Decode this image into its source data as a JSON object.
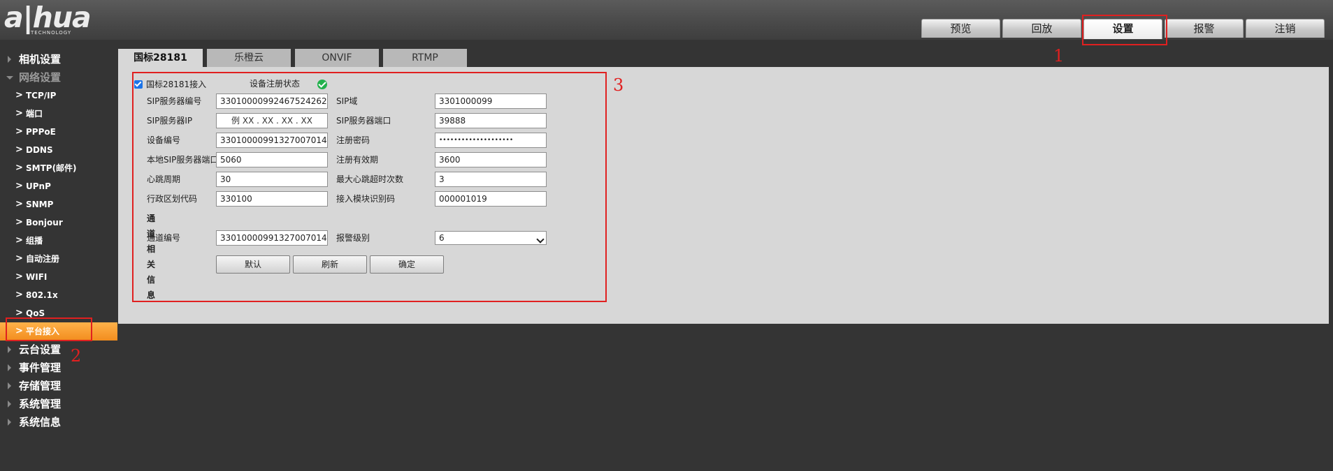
{
  "logo": {
    "main": "a|hua",
    "sub": "TECHNOLOGY"
  },
  "top_nav": [
    "预览",
    "回放",
    "设置",
    "报警",
    "注销"
  ],
  "sidebar": {
    "camera": "相机设置",
    "network": "网络设置",
    "network_items": [
      "TCP/IP",
      "端口",
      "PPPoE",
      "DDNS",
      "SMTP(邮件)",
      "UPnP",
      "SNMP",
      "Bonjour",
      "组播",
      "自动注册",
      "WIFI",
      "802.1x",
      "QoS",
      "平台接入"
    ],
    "categories": [
      "云台设置",
      "事件管理",
      "存储管理",
      "系统管理",
      "系统信息"
    ]
  },
  "tabs": [
    "国标28181",
    "乐橙云",
    "ONVIF",
    "RTMP"
  ],
  "form": {
    "enable_label": "国标28181接入",
    "status_label": "设备注册状态",
    "sip_server_id_label": "SIP服务器编号",
    "sip_server_id": "33010000992467524262",
    "sip_domain_label": "SIP域",
    "sip_domain": "3301000099",
    "sip_server_ip_label": "SIP服务器IP",
    "sip_server_ip_placeholder": "例 XX . XX . XX . XX",
    "sip_server_port_label": "SIP服务器端口",
    "sip_server_port": "39888",
    "device_id_label": "设备编号",
    "device_id": "33010000991327007014",
    "reg_password_label": "注册密码",
    "reg_password": "••••••••••••••••••••",
    "local_sip_port_label": "本地SIP服务器端口",
    "local_sip_port": "5060",
    "reg_validity_label": "注册有效期",
    "reg_validity": "3600",
    "heartbeat_label": "心跳周期",
    "heartbeat": "30",
    "max_heartbeat_timeout_label": "最大心跳超时次数",
    "max_heartbeat_timeout": "3",
    "region_code_label": "行政区划代码",
    "region_code": "330100",
    "module_id_label": "接入模块识别码",
    "module_id": "000001019",
    "channel_section": "通道相关信息",
    "channel_id_label": "通道编号",
    "channel_id": "33010000991327007014",
    "alarm_level_label": "报警级别",
    "alarm_level": "6",
    "btn_default": "默认",
    "btn_refresh": "刷新",
    "btn_ok": "确定"
  },
  "annotations": [
    "1",
    "2",
    "3"
  ],
  "colors": {
    "accent": "#f28d1e",
    "annotation": "#e02020",
    "status_ok": "#22b14c"
  }
}
